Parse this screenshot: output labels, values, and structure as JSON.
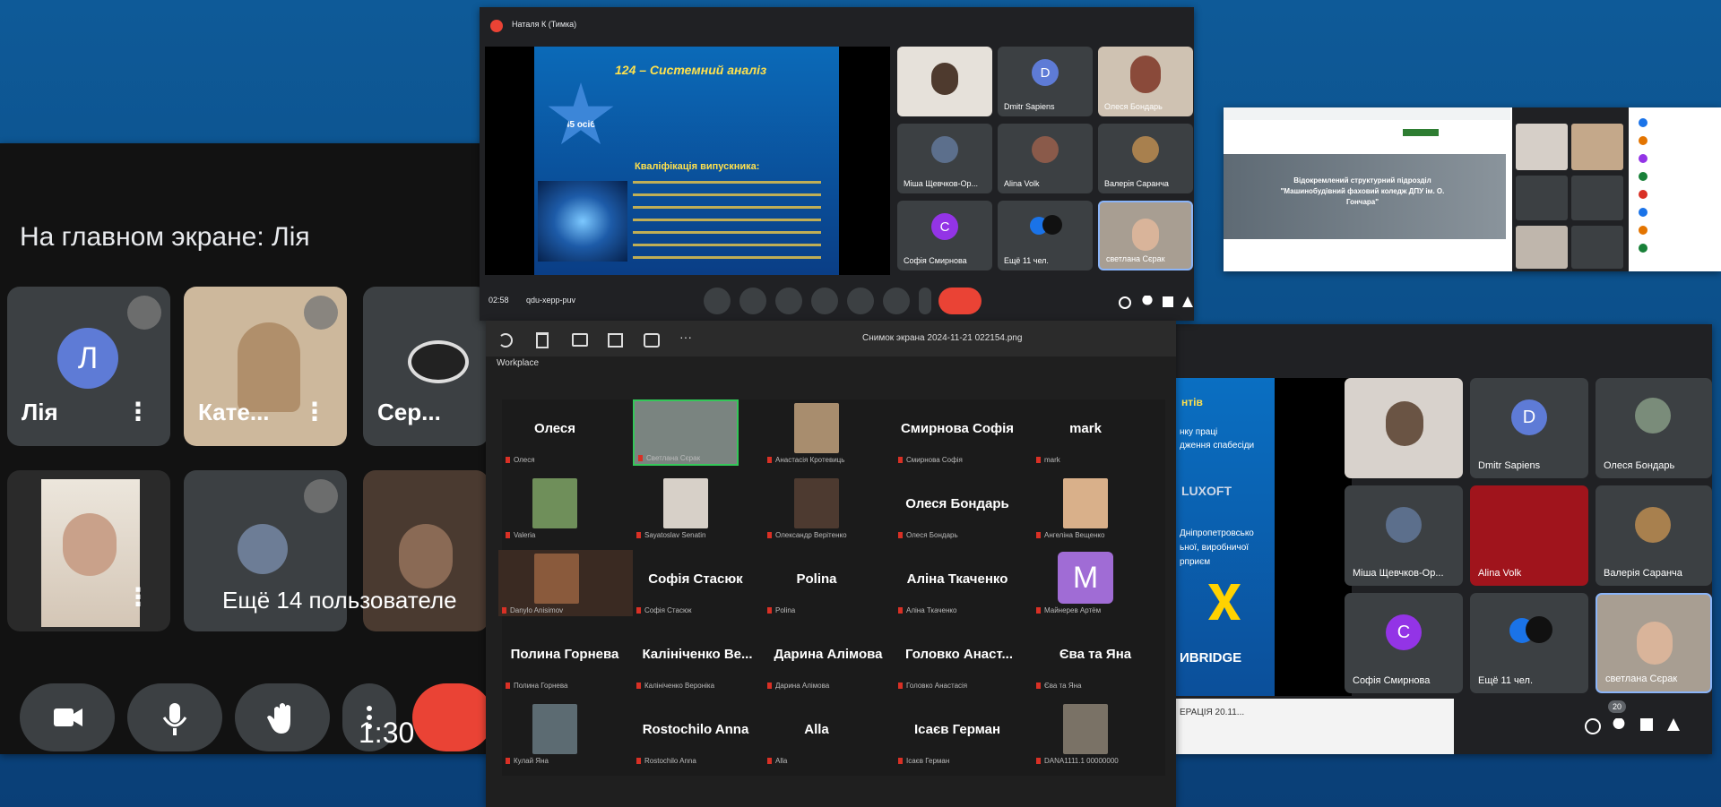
{
  "phone": {
    "caption": "На главном экране: Лія",
    "tiles": [
      {
        "name": "Лія",
        "avatar": "Л"
      },
      {
        "name": "Кате..."
      },
      {
        "name": "Сер..."
      }
    ],
    "more_users": "Ещё 14 пользователе",
    "timer": "1:30"
  },
  "meeting1": {
    "title": "Наталя К (Тимка)",
    "slide_title": "124 – Системний аналіз",
    "slide_badge": "45 осіб",
    "slide_subtitle": "Кваліфікація випускника:",
    "participants": [
      "Dmitr Sapiens",
      "Олеся Бондарь",
      "Міша Щевчков-Ор...",
      "Alina Volk",
      "Валерія Саранча",
      "Софія Смирнова",
      "Ещё 11 чел.",
      "светлана Сєрак"
    ],
    "avatar_d": "D",
    "avatar_c": "C",
    "time": "02:58",
    "code": "qdu-xepp-puv"
  },
  "meeting2": {
    "participants": [
      "Dmitr Sapiens",
      "Олеся Бондарь",
      "Міша Щевчков-Ор...",
      "Alina Volk",
      "Валерія Саранча",
      "Софія Смирнова",
      "Ещё 11 чел.",
      "светлана Сєрак"
    ],
    "avatar_d": "D",
    "avatar_c": "C",
    "count": "20",
    "slide_partial_lines": [
      "нтів",
      "нку праці",
      "дження спабесіди",
      "LUXOFT",
      "Дніпропетровсько",
      "ьної, виробничої",
      "рприєм",
      "ИBRIDGE"
    ],
    "taskbar_text": "ЕРАЦІЯ 20.11..."
  },
  "workplace": {
    "file_title": "Снимок экрана 2024-11-21 022154.png",
    "label": "Workplace",
    "tiles": [
      {
        "name": "Олеся",
        "sub": "Олеся"
      },
      {
        "name": "",
        "sub": "Светлана Сєрак"
      },
      {
        "name": "",
        "sub": "Анастасія Кротевиць"
      },
      {
        "name": "Смирнова Софія",
        "sub": "Смирнова Софія"
      },
      {
        "name": "mark",
        "sub": "mark"
      },
      {
        "name": "",
        "sub": "Valeria"
      },
      {
        "name": "",
        "sub": "Sayatoslav Senatin"
      },
      {
        "name": "",
        "sub": "Олександр Верітенко"
      },
      {
        "name": "Олеся Бондарь",
        "sub": "Олеся Бондарь"
      },
      {
        "name": "",
        "sub": "Ангеліна Вещенко"
      },
      {
        "name": "",
        "sub": "Danylo Anisimov"
      },
      {
        "name": "Софія Стасюк",
        "sub": "Софія Стасюк"
      },
      {
        "name": "Polina",
        "sub": "Polina"
      },
      {
        "name": "Аліна Ткаченко",
        "sub": "Аліна Ткаченко"
      },
      {
        "name": "",
        "sub": "Майнерев Артём",
        "avatar": "M"
      },
      {
        "name": "Полина Горнева",
        "sub": "Полина Горнева"
      },
      {
        "name": "Калініченко Ве...",
        "sub": "Калініченко Вероніка"
      },
      {
        "name": "Дарина Алімова",
        "sub": "Дарина Алімова"
      },
      {
        "name": "Головко Анаст...",
        "sub": "Головко Анастасія"
      },
      {
        "name": "Єва та Яна",
        "sub": "Єва та Яна"
      },
      {
        "name": "",
        "sub": "Кулай Яна"
      },
      {
        "name": "Rostochilo Anna",
        "sub": "Rostochilo Anna"
      },
      {
        "name": "Alla",
        "sub": "Alla"
      },
      {
        "name": "Ісаєв Герман",
        "sub": "Ісаєв Герман"
      },
      {
        "name": "",
        "sub": "DANA1111.1 00000000"
      }
    ]
  },
  "browser": {
    "banner_text": "Відокремлений структурний підрозділ \"Машинобудівний фаховий коледж ДПУ ім. О. Гончара\""
  }
}
